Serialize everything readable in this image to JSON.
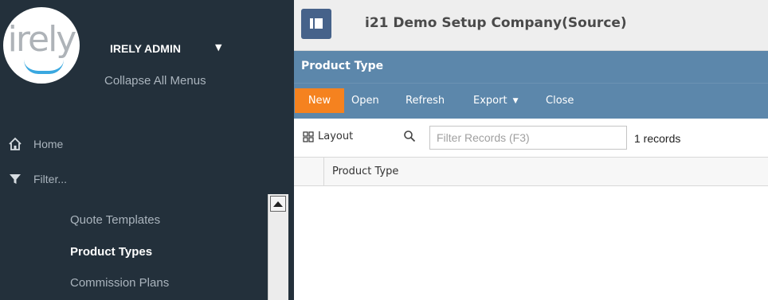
{
  "sidebar": {
    "logo_text": "irely",
    "user_name": "IRELY ADMIN",
    "collapse_label": "Collapse All Menus",
    "nav": {
      "home": "Home",
      "filter": "Filter..."
    },
    "menu_items": [
      {
        "label": "Quote Templates",
        "active": false
      },
      {
        "label": "Product Types",
        "active": true
      },
      {
        "label": "Commission Plans",
        "active": false
      }
    ]
  },
  "topbar": {
    "company": "i21 Demo Setup Company(Source)"
  },
  "panel": {
    "title": "Product Type",
    "toolbar": {
      "new": "New",
      "open": "Open",
      "refresh": "Refresh",
      "export": "Export",
      "close": "Close"
    },
    "grid": {
      "layout_label": "Layout",
      "filter_placeholder": "Filter Records (F3)",
      "filter_value": "",
      "record_count": "1 records",
      "columns": [
        "Product Type"
      ]
    }
  },
  "colors": {
    "sidebar_bg": "#23303b",
    "panel_blue": "#5c87ab",
    "accent_orange": "#f5821f",
    "toggle_blue": "#46628a"
  },
  "icons": {
    "home": "home-icon",
    "filter": "funnel-icon",
    "layout": "grid-layout-icon",
    "search": "search-icon",
    "toggle": "sidebar-toggle-icon"
  }
}
